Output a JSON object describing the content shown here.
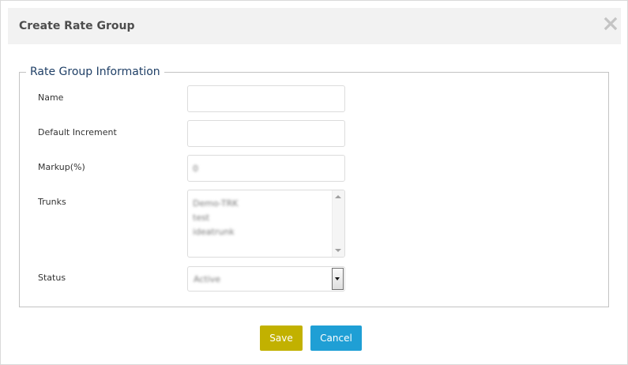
{
  "dialog": {
    "title": "Create Rate Group",
    "close_icon": "close-icon"
  },
  "fieldset": {
    "legend": "Rate Group Information"
  },
  "form": {
    "name": {
      "label": "Name",
      "value": ""
    },
    "default_increment": {
      "label": "Default Increment",
      "value": ""
    },
    "markup": {
      "label": "Markup(%)",
      "value": "0"
    },
    "trunks": {
      "label": "Trunks",
      "options": [
        "Demo-TRK",
        "test",
        "ideatrunk"
      ]
    },
    "status": {
      "label": "Status",
      "selected": "Active"
    }
  },
  "buttons": {
    "save": "Save",
    "cancel": "Cancel"
  },
  "colors": {
    "save_button": "#c2b100",
    "cancel_button": "#1f9fd5",
    "legend_text": "#1f3f66",
    "header_bg": "#f2f2f2"
  }
}
